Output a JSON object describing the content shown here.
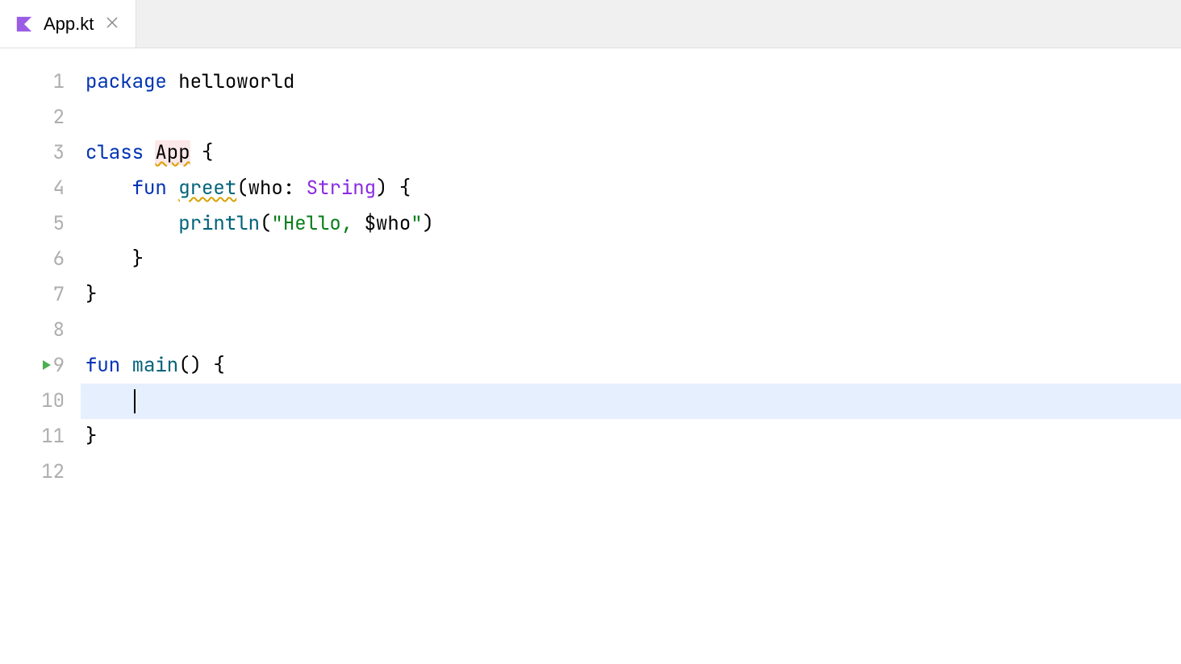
{
  "tab": {
    "filename": "App.kt"
  },
  "code": {
    "lines": [
      {
        "num": "1",
        "tokens": [
          {
            "t": "package",
            "cls": "kw"
          },
          {
            "t": " ",
            "cls": ""
          },
          {
            "t": "helloworld",
            "cls": "ident"
          }
        ]
      },
      {
        "num": "2",
        "tokens": []
      },
      {
        "num": "3",
        "tokens": [
          {
            "t": "class",
            "cls": "kw"
          },
          {
            "t": " ",
            "cls": ""
          },
          {
            "t": "App",
            "cls": "ident warn-underline highlight-bg"
          },
          {
            "t": " {",
            "cls": ""
          }
        ]
      },
      {
        "num": "4",
        "tokens": [
          {
            "t": "    ",
            "cls": ""
          },
          {
            "t": "fun",
            "cls": "kw"
          },
          {
            "t": " ",
            "cls": ""
          },
          {
            "t": "greet",
            "cls": "fn-name warn-underline"
          },
          {
            "t": "(",
            "cls": ""
          },
          {
            "t": "who",
            "cls": "ident"
          },
          {
            "t": ": ",
            "cls": ""
          },
          {
            "t": "String",
            "cls": "type"
          },
          {
            "t": ") {",
            "cls": ""
          }
        ]
      },
      {
        "num": "5",
        "tokens": [
          {
            "t": "        ",
            "cls": ""
          },
          {
            "t": "println",
            "cls": "fn-call"
          },
          {
            "t": "(",
            "cls": ""
          },
          {
            "t": "\"Hello, ",
            "cls": "str"
          },
          {
            "t": "$who",
            "cls": "var-ref"
          },
          {
            "t": "\"",
            "cls": "str"
          },
          {
            "t": ")",
            "cls": ""
          }
        ]
      },
      {
        "num": "6",
        "tokens": [
          {
            "t": "    }",
            "cls": ""
          }
        ]
      },
      {
        "num": "7",
        "tokens": [
          {
            "t": "}",
            "cls": ""
          }
        ]
      },
      {
        "num": "8",
        "tokens": []
      },
      {
        "num": "9",
        "runIcon": true,
        "tokens": [
          {
            "t": "fun",
            "cls": "kw"
          },
          {
            "t": " ",
            "cls": ""
          },
          {
            "t": "main",
            "cls": "fn-name"
          },
          {
            "t": "() {",
            "cls": ""
          }
        ]
      },
      {
        "num": "10",
        "current": true,
        "cursor": true,
        "tokens": []
      },
      {
        "num": "11",
        "tokens": [
          {
            "t": "}",
            "cls": ""
          }
        ]
      },
      {
        "num": "12",
        "tokens": []
      }
    ]
  }
}
